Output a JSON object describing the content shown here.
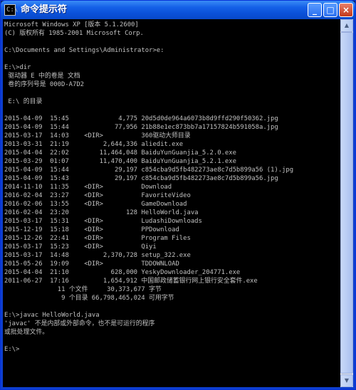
{
  "window": {
    "title": "命令提示符",
    "icon_text": "C:\\",
    "controls": {
      "minimize": "_",
      "maximize": "□",
      "close": "×"
    }
  },
  "console": {
    "lines": [
      "Microsoft Windows XP [版本 5.1.2600]",
      "(C) 版权所有 1985-2001 Microsoft Corp.",
      "",
      "C:\\Documents and Settings\\Administrator>e:",
      "",
      "E:\\>dir",
      " 驱动器 E 中的卷是 文档",
      " 卷的序列号是 000D-A7D2",
      "",
      " E:\\ 的目录",
      "",
      "2015-04-09  15:45             4,775 20d5d0de964a6073b8d9ffd290f50362.jpg",
      "2015-04-09  15:44            77,956 21b88e1ec873bb7a17157824b591058a.jpg",
      "2015-03-17  14:03    <DIR>          360驱动大师目录",
      "2013-03-31  21:19         2,644,336 aliedit.exe",
      "2015-04-04  22:02        11,464,048 BaiduYunGuanjia_5.2.0.exe",
      "2015-03-29  01:07        11,470,400 BaiduYunGuanjia_5.2.1.exe",
      "2015-04-09  15:44            29,197 c854cba9d5fb482273ae8c7d5b899a56 (1).jpg",
      "2015-04-09  15:43            29,197 c854cba9d5fb482273ae8c7d5b899a56.jpg",
      "2014-11-10  11:35    <DIR>          Download",
      "2016-02-04  23:27    <DIR>          FavoriteVideo",
      "2016-02-06  13:55    <DIR>          GameDownload",
      "2016-02-04  23:20               128 HelloWorld.java",
      "2015-03-17  15:31    <DIR>          LudashiDownloads",
      "2015-12-19  15:18    <DIR>          PPDownload",
      "2015-12-26  22:41    <DIR>          Program Files",
      "2015-03-17  15:23    <DIR>          Qiyi",
      "2015-03-17  14:48         2,370,728 setup_322.exe",
      "2015-05-26  19:09    <DIR>          TDDOWNLOAD",
      "2015-04-04  21:10           628,000 YeskyDownloader_204771.exe",
      "2011-06-27  17:16         1,654,912 中国邮政储蓄银行网上银行安全套件.exe",
      "              11 个文件     30,373,677 字节",
      "               9 个目录 66,798,465,024 可用字节",
      "",
      "E:\\>javac HelloWorld.java",
      "'javac' 不是内部或外部命令，也不是可运行的程序",
      "或批处理文件。",
      "",
      "E:\\>"
    ]
  },
  "scrollbar": {
    "up_arrow": "▲",
    "down_arrow": "▼"
  }
}
